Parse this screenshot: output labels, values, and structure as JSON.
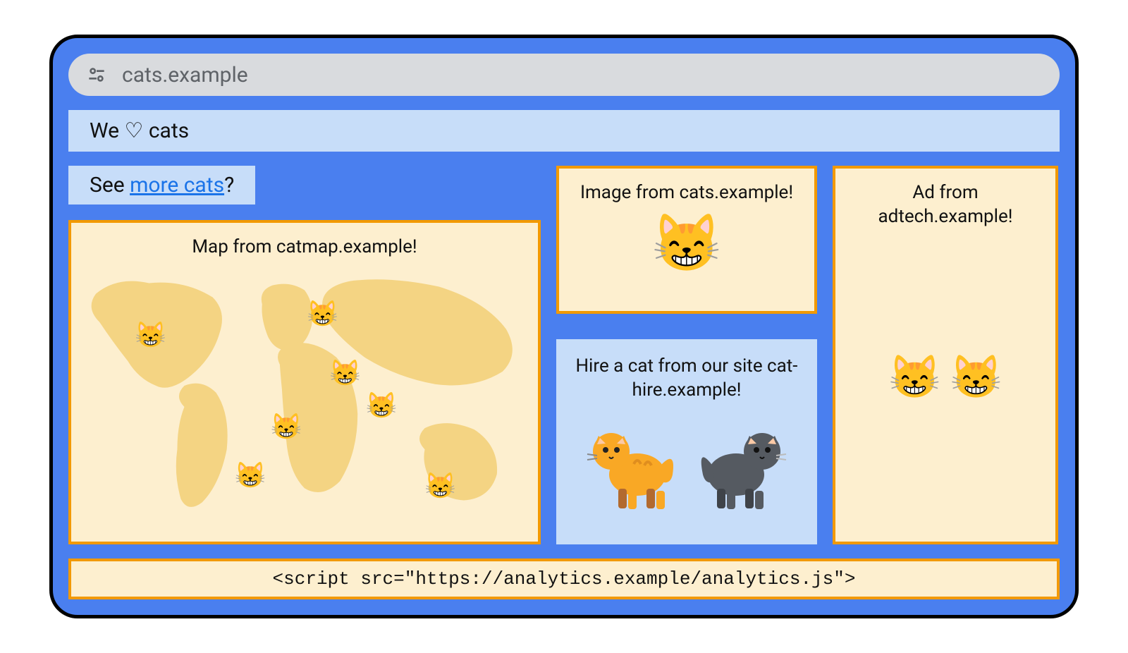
{
  "address_bar": {
    "url": "cats.example",
    "icon": "site-settings-icon"
  },
  "header": {
    "title": "We ♡ cats"
  },
  "link_banner": {
    "prefix": "See ",
    "link_text": "more cats",
    "suffix": "?"
  },
  "panels": {
    "map": {
      "title": "Map from catmap.example!",
      "marker_icon": "cat-face-icon"
    },
    "image": {
      "title": "Image from cats.example!",
      "icon": "cat-face-icon"
    },
    "hire": {
      "title": "Hire a cat from our site cat-hire.example!",
      "cat_a_icon": "orange-cat-icon",
      "cat_b_icon": "grey-cat-icon"
    },
    "ad": {
      "title": "Ad from adtech.example!",
      "icon": "cat-face-icon"
    }
  },
  "script_bar": {
    "code": "<script src=\"https://analytics.example/analytics.js\">"
  },
  "colors": {
    "browser_frame": "#4a7fef",
    "panel_border": "#f29900",
    "panel_bg": "#fdefcf",
    "light_blue": "#c7ddf9"
  }
}
